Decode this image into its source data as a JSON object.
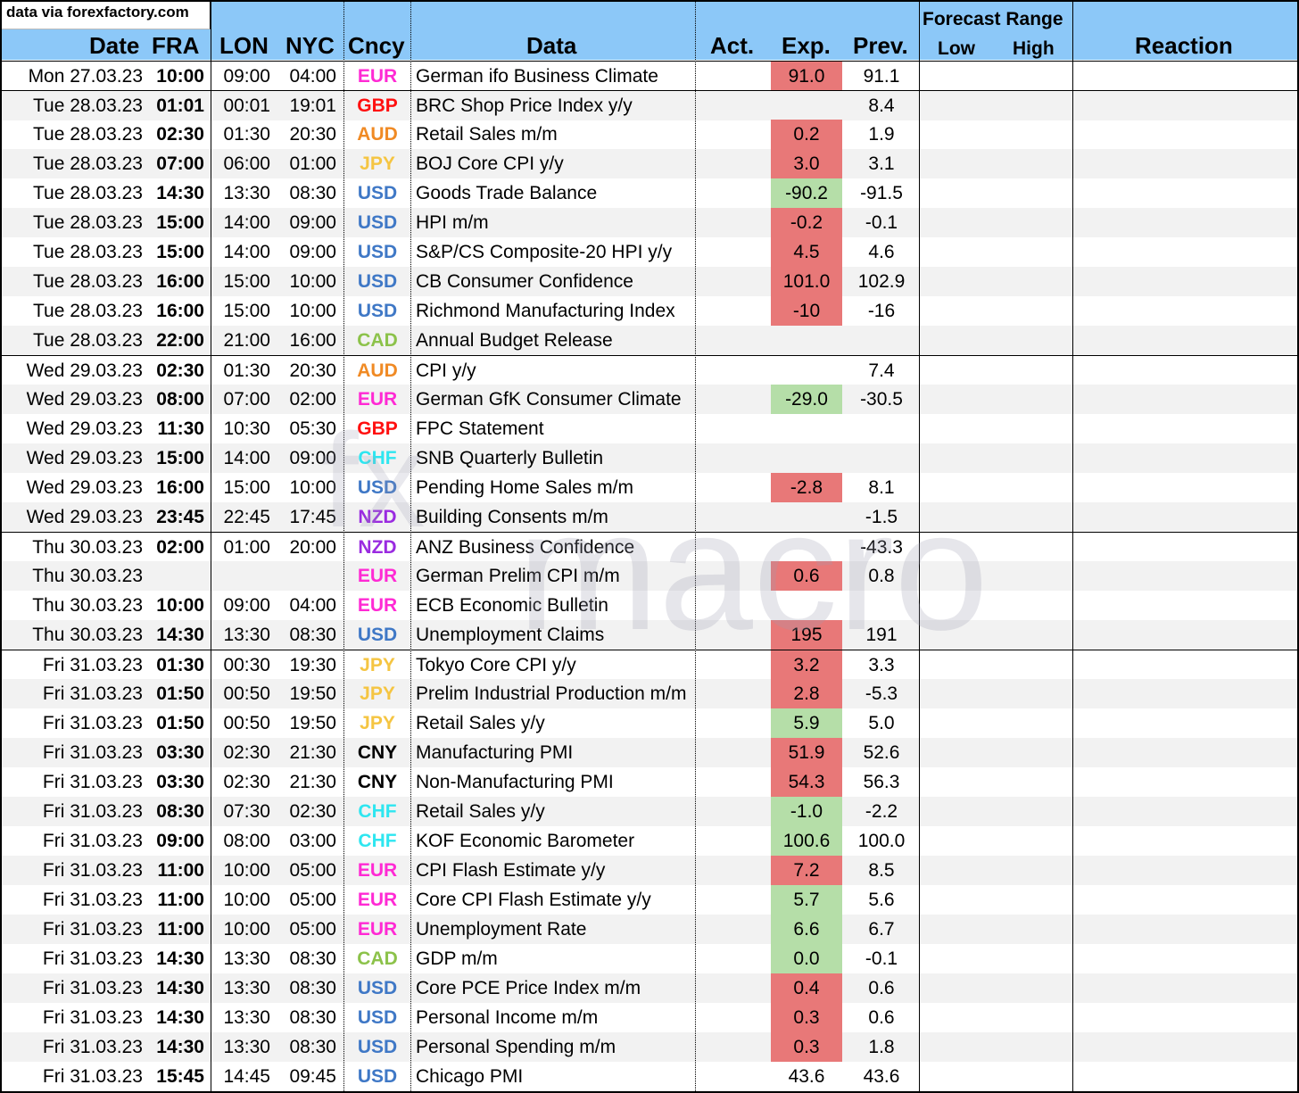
{
  "source_note": "data via forexfactory.com",
  "header": {
    "date": "Date",
    "fra": "FRA",
    "lon": "LON",
    "nyc": "NYC",
    "ccy": "Cncy",
    "data": "Data",
    "act": "Act.",
    "exp": "Exp.",
    "prev": "Prev.",
    "forecast_range": "Forecast Range",
    "low": "Low",
    "high": "High",
    "reaction": "Reaction"
  },
  "watermark": {
    "prefix": "fx",
    "word": "macro"
  },
  "currency_colors": {
    "EUR": "#ff2ad4",
    "GBP": "#ff1010",
    "AUD": "#f08a24",
    "JPY": "#f5c542",
    "USD": "#3f78c6",
    "CAD": "#8cc24a",
    "CHF": "#2ee6f0",
    "NZD": "#9a2be0",
    "CNY": "#000000"
  },
  "rows": [
    {
      "date": "Mon 27.03.23",
      "fra": "10:00",
      "lon": "09:00",
      "nyc": "04:00",
      "ccy": "EUR",
      "data": "German ifo Business Climate",
      "act": "",
      "exp": "91.0",
      "exp_style": "red",
      "prev": "91.1",
      "group_start": true
    },
    {
      "date": "Tue 28.03.23",
      "fra": "01:01",
      "lon": "00:01",
      "nyc": "19:01",
      "ccy": "GBP",
      "data": "BRC Shop Price Index y/y",
      "act": "",
      "exp": "",
      "exp_style": "",
      "prev": "8.4",
      "group_start": true
    },
    {
      "date": "Tue 28.03.23",
      "fra": "02:30",
      "lon": "01:30",
      "nyc": "20:30",
      "ccy": "AUD",
      "data": "Retail Sales m/m",
      "act": "",
      "exp": "0.2",
      "exp_style": "red",
      "prev": "1.9"
    },
    {
      "date": "Tue 28.03.23",
      "fra": "07:00",
      "lon": "06:00",
      "nyc": "01:00",
      "ccy": "JPY",
      "data": "BOJ Core CPI y/y",
      "act": "",
      "exp": "3.0",
      "exp_style": "red",
      "prev": "3.1"
    },
    {
      "date": "Tue 28.03.23",
      "fra": "14:30",
      "lon": "13:30",
      "nyc": "08:30",
      "ccy": "USD",
      "data": "Goods Trade Balance",
      "act": "",
      "exp": "-90.2",
      "exp_style": "green",
      "prev": "-91.5"
    },
    {
      "date": "Tue 28.03.23",
      "fra": "15:00",
      "lon": "14:00",
      "nyc": "09:00",
      "ccy": "USD",
      "data": "HPI m/m",
      "act": "",
      "exp": "-0.2",
      "exp_style": "red",
      "prev": "-0.1"
    },
    {
      "date": "Tue 28.03.23",
      "fra": "15:00",
      "lon": "14:00",
      "nyc": "09:00",
      "ccy": "USD",
      "data": "S&P/CS Composite-20 HPI y/y",
      "act": "",
      "exp": "4.5",
      "exp_style": "red",
      "prev": "4.6"
    },
    {
      "date": "Tue 28.03.23",
      "fra": "16:00",
      "lon": "15:00",
      "nyc": "10:00",
      "ccy": "USD",
      "data": "CB Consumer Confidence",
      "act": "",
      "exp": "101.0",
      "exp_style": "red",
      "prev": "102.9"
    },
    {
      "date": "Tue 28.03.23",
      "fra": "16:00",
      "lon": "15:00",
      "nyc": "10:00",
      "ccy": "USD",
      "data": "Richmond Manufacturing Index",
      "act": "",
      "exp": "-10",
      "exp_style": "red",
      "prev": "-16"
    },
    {
      "date": "Tue 28.03.23",
      "fra": "22:00",
      "lon": "21:00",
      "nyc": "16:00",
      "ccy": "CAD",
      "data": "Annual Budget Release",
      "act": "",
      "exp": "",
      "exp_style": "",
      "prev": ""
    },
    {
      "date": "Wed 29.03.23",
      "fra": "02:30",
      "lon": "01:30",
      "nyc": "20:30",
      "ccy": "AUD",
      "data": "CPI y/y",
      "act": "",
      "exp": "",
      "exp_style": "",
      "prev": "7.4",
      "group_start": true
    },
    {
      "date": "Wed 29.03.23",
      "fra": "08:00",
      "lon": "07:00",
      "nyc": "02:00",
      "ccy": "EUR",
      "data": "German GfK Consumer Climate",
      "act": "",
      "exp": "-29.0",
      "exp_style": "green",
      "prev": "-30.5"
    },
    {
      "date": "Wed 29.03.23",
      "fra": "11:30",
      "lon": "10:30",
      "nyc": "05:30",
      "ccy": "GBP",
      "data": "FPC Statement",
      "act": "",
      "exp": "",
      "exp_style": "",
      "prev": ""
    },
    {
      "date": "Wed 29.03.23",
      "fra": "15:00",
      "lon": "14:00",
      "nyc": "09:00",
      "ccy": "CHF",
      "data": "SNB Quarterly Bulletin",
      "act": "",
      "exp": "",
      "exp_style": "",
      "prev": ""
    },
    {
      "date": "Wed 29.03.23",
      "fra": "16:00",
      "lon": "15:00",
      "nyc": "10:00",
      "ccy": "USD",
      "data": "Pending Home Sales m/m",
      "act": "",
      "exp": "-2.8",
      "exp_style": "red",
      "prev": "8.1"
    },
    {
      "date": "Wed 29.03.23",
      "fra": "23:45",
      "lon": "22:45",
      "nyc": "17:45",
      "ccy": "NZD",
      "data": "Building Consents m/m",
      "act": "",
      "exp": "",
      "exp_style": "",
      "prev": "-1.5"
    },
    {
      "date": "Thu 30.03.23",
      "fra": "02:00",
      "lon": "01:00",
      "nyc": "20:00",
      "ccy": "NZD",
      "data": "ANZ Business Confidence",
      "act": "",
      "exp": "",
      "exp_style": "",
      "prev": "-43.3",
      "group_start": true
    },
    {
      "date": "Thu 30.03.23",
      "fra": "",
      "lon": "",
      "nyc": "",
      "ccy": "EUR",
      "data": "German Prelim CPI m/m",
      "act": "",
      "exp": "0.6",
      "exp_style": "red",
      "prev": "0.8"
    },
    {
      "date": "Thu 30.03.23",
      "fra": "10:00",
      "lon": "09:00",
      "nyc": "04:00",
      "ccy": "EUR",
      "data": "ECB Economic Bulletin",
      "act": "",
      "exp": "",
      "exp_style": "",
      "prev": ""
    },
    {
      "date": "Thu 30.03.23",
      "fra": "14:30",
      "lon": "13:30",
      "nyc": "08:30",
      "ccy": "USD",
      "data": "Unemployment Claims",
      "act": "",
      "exp": "195",
      "exp_style": "red",
      "prev": "191"
    },
    {
      "date": "Fri 31.03.23",
      "fra": "01:30",
      "lon": "00:30",
      "nyc": "19:30",
      "ccy": "JPY",
      "data": "Tokyo Core CPI y/y",
      "act": "",
      "exp": "3.2",
      "exp_style": "red",
      "prev": "3.3",
      "group_start": true
    },
    {
      "date": "Fri 31.03.23",
      "fra": "01:50",
      "lon": "00:50",
      "nyc": "19:50",
      "ccy": "JPY",
      "data": "Prelim Industrial Production m/m",
      "act": "",
      "exp": "2.8",
      "exp_style": "red",
      "prev": "-5.3"
    },
    {
      "date": "Fri 31.03.23",
      "fra": "01:50",
      "lon": "00:50",
      "nyc": "19:50",
      "ccy": "JPY",
      "data": "Retail Sales y/y",
      "act": "",
      "exp": "5.9",
      "exp_style": "green",
      "prev": "5.0"
    },
    {
      "date": "Fri 31.03.23",
      "fra": "03:30",
      "lon": "02:30",
      "nyc": "21:30",
      "ccy": "CNY",
      "data": "Manufacturing PMI",
      "act": "",
      "exp": "51.9",
      "exp_style": "red",
      "prev": "52.6"
    },
    {
      "date": "Fri 31.03.23",
      "fra": "03:30",
      "lon": "02:30",
      "nyc": "21:30",
      "ccy": "CNY",
      "data": "Non-Manufacturing PMI",
      "act": "",
      "exp": "54.3",
      "exp_style": "red",
      "prev": "56.3"
    },
    {
      "date": "Fri 31.03.23",
      "fra": "08:30",
      "lon": "07:30",
      "nyc": "02:30",
      "ccy": "CHF",
      "data": "Retail Sales y/y",
      "act": "",
      "exp": "-1.0",
      "exp_style": "green",
      "prev": "-2.2"
    },
    {
      "date": "Fri 31.03.23",
      "fra": "09:00",
      "lon": "08:00",
      "nyc": "03:00",
      "ccy": "CHF",
      "data": "KOF Economic Barometer",
      "act": "",
      "exp": "100.6",
      "exp_style": "green",
      "prev": "100.0"
    },
    {
      "date": "Fri 31.03.23",
      "fra": "11:00",
      "lon": "10:00",
      "nyc": "05:00",
      "ccy": "EUR",
      "data": "CPI Flash Estimate y/y",
      "act": "",
      "exp": "7.2",
      "exp_style": "red",
      "prev": "8.5"
    },
    {
      "date": "Fri 31.03.23",
      "fra": "11:00",
      "lon": "10:00",
      "nyc": "05:00",
      "ccy": "EUR",
      "data": "Core CPI Flash Estimate y/y",
      "act": "",
      "exp": "5.7",
      "exp_style": "green",
      "prev": "5.6"
    },
    {
      "date": "Fri 31.03.23",
      "fra": "11:00",
      "lon": "10:00",
      "nyc": "05:00",
      "ccy": "EUR",
      "data": "Unemployment Rate",
      "act": "",
      "exp": "6.6",
      "exp_style": "green",
      "prev": "6.7"
    },
    {
      "date": "Fri 31.03.23",
      "fra": "14:30",
      "lon": "13:30",
      "nyc": "08:30",
      "ccy": "CAD",
      "data": "GDP m/m",
      "act": "",
      "exp": "0.0",
      "exp_style": "green",
      "prev": "-0.1"
    },
    {
      "date": "Fri 31.03.23",
      "fra": "14:30",
      "lon": "13:30",
      "nyc": "08:30",
      "ccy": "USD",
      "data": "Core PCE Price Index m/m",
      "act": "",
      "exp": "0.4",
      "exp_style": "red",
      "prev": "0.6"
    },
    {
      "date": "Fri 31.03.23",
      "fra": "14:30",
      "lon": "13:30",
      "nyc": "08:30",
      "ccy": "USD",
      "data": "Personal Income m/m",
      "act": "",
      "exp": "0.3",
      "exp_style": "red",
      "prev": "0.6"
    },
    {
      "date": "Fri 31.03.23",
      "fra": "14:30",
      "lon": "13:30",
      "nyc": "08:30",
      "ccy": "USD",
      "data": "Personal Spending m/m",
      "act": "",
      "exp": "0.3",
      "exp_style": "red",
      "prev": "1.8"
    },
    {
      "date": "Fri 31.03.23",
      "fra": "15:45",
      "lon": "14:45",
      "nyc": "09:45",
      "ccy": "USD",
      "data": "Chicago PMI",
      "act": "",
      "exp": "43.6",
      "exp_style": "",
      "prev": "43.6"
    }
  ]
}
